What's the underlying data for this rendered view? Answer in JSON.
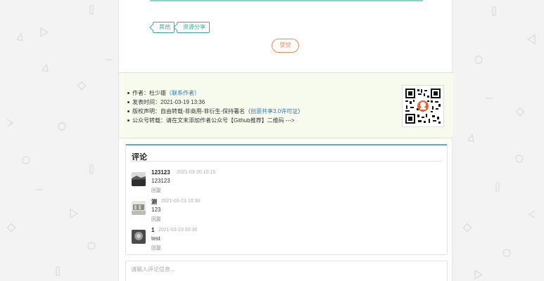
{
  "article": {
    "tags": [
      "其他",
      "资源分享"
    ],
    "reward_label": "赞赏"
  },
  "copyright": {
    "author_label": "作者：",
    "author_name": "杜少雄",
    "contact_link": "（联系作者）",
    "publish_label": "发表时间：",
    "publish_time": "2021-03-19 13:36",
    "license_label": "版权声明：",
    "license_text": "自由转载-非商用-非衍生-保持署名（",
    "license_link": "创意共享3.0许可证",
    "license_end": "）",
    "repost_label": "公众号转载：",
    "repost_text": "请在文末添加作者公众号【Github推荐】二维码 --->",
    "qr_icon": "qr-code-icon"
  },
  "comments": {
    "title": "评论",
    "items": [
      {
        "name": "123123",
        "time": "2021-03-20 10:15",
        "content": "123123",
        "reply": "回复",
        "avatar_color": "#2f2f2f"
      },
      {
        "name": "测",
        "time": "2021-03-23 10:30",
        "content": "123",
        "reply": "回复",
        "avatar_color": "#8a8f84"
      },
      {
        "name": "1",
        "time": "2021-03-23 20:30",
        "content": "test",
        "reply": "回复",
        "avatar_color": "#4a4a4a"
      }
    ]
  },
  "input": {
    "placeholder": "请输入评论信息..."
  },
  "colors": {
    "accent": "#2ab3a4",
    "reward": "#f08a4b",
    "link": "#2a7ab8",
    "comment_border": "#48b5d8"
  }
}
